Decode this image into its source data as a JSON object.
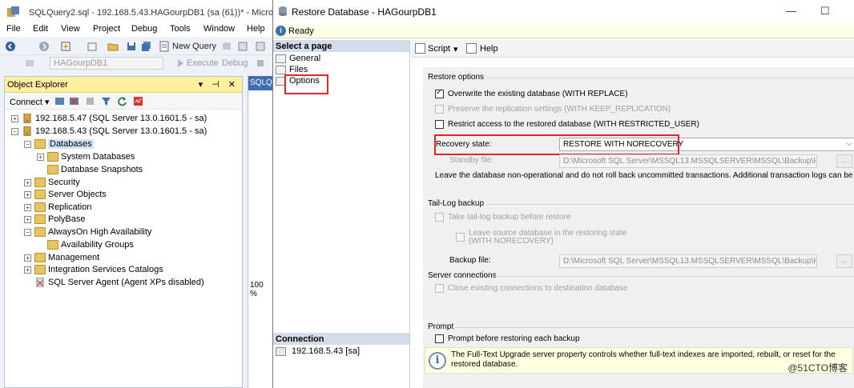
{
  "ssms": {
    "title": "SQLQuery2.sql - 192.168.5.43.HAGourpDB1 (sa (61))* - Microsoft S",
    "menu": [
      "File",
      "Edit",
      "View",
      "Project",
      "Debug",
      "Tools",
      "Window",
      "Help"
    ],
    "toolbar": {
      "new_query": "New Query",
      "db_selector": "HAGourpDB1",
      "execute": "Execute",
      "debug": "Debug"
    },
    "object_explorer": {
      "title": "Object Explorer",
      "pin_controls": "▾ ⊣ ✕",
      "connect": "Connect ▾",
      "nodes": [
        {
          "label": "192.168.5.47 (SQL Server 13.0.1601.5 - sa)",
          "expander": "+"
        },
        {
          "label": "192.168.5.43 (SQL Server 13.0.1601.5 - sa)",
          "expander": "−"
        },
        {
          "label": "Databases",
          "expander": "−"
        },
        {
          "label": "System Databases",
          "expander": "+"
        },
        {
          "label": "Database Snapshots",
          "expander": ""
        },
        {
          "label": "Security",
          "expander": "+"
        },
        {
          "label": "Server Objects",
          "expander": "+"
        },
        {
          "label": "Replication",
          "expander": "+"
        },
        {
          "label": "PolyBase",
          "expander": "+"
        },
        {
          "label": "AlwaysOn High Availability",
          "expander": "−"
        },
        {
          "label": "Availability Groups",
          "expander": ""
        },
        {
          "label": "Management",
          "expander": "+"
        },
        {
          "label": "Integration Services Catalogs",
          "expander": "+"
        },
        {
          "label": "SQL Server Agent (Agent XPs disabled)",
          "expander": ""
        }
      ]
    },
    "editor_tab": "SQLQ",
    "zoom": "100 %"
  },
  "dialog": {
    "title": "Restore Database - HAGourpDB1",
    "status": "Ready",
    "select_page_header": "Select a page",
    "pages": [
      "General",
      "Files",
      "Options"
    ],
    "connection_header": "Connection",
    "connection_item": "192.168.5.43 [sa]",
    "toolbar": {
      "script": "Script",
      "script_arrow": "▾",
      "help": "Help"
    },
    "restore_options": {
      "title": "Restore options",
      "overwrite": "Overwrite the existing database (WITH REPLACE)",
      "preserve": "Preserve the replication settings (WITH KEEP_REPLICATION)",
      "restrict": "Restrict access to the restored database (WITH RESTRICTED_USER)",
      "recovery_label": "Recovery state:",
      "recovery_value": "RESTORE WITH NORECOVERY",
      "standby_label": "Standby file:",
      "standby_value": "D:\\Microsoft SQL Server\\MSSQL13.MSSQLSERVER\\MSSQL\\Backup\\HAG",
      "standby_btn": "...",
      "description": "Leave the database non-operational and do not roll back uncommitted transactions. Additional transaction logs can be restored."
    },
    "tail_log": {
      "title": "Tail-Log backup",
      "take_backup": "Take tail-log backup before restore",
      "leave_source_1": "Leave source database in the restoring state",
      "leave_source_2": "(WITH NORECOVERY)",
      "backup_file_label": "Backup file:",
      "backup_file_value": "D:\\Microsoft SQL Server\\MSSQL13.MSSQLSERVER\\MSSQL\\Backup\\HAG",
      "backup_btn": "..."
    },
    "server_connections": {
      "title": "Server connections",
      "close_existing": "Close existing connections to destination database"
    },
    "prompt": {
      "title": "Prompt",
      "prompt_before": "Prompt before restoring each backup"
    },
    "info": {
      "icon": "i",
      "text": "The Full-Text Upgrade server property controls whether full-text indexes are imported, rebuilt, or reset for the restored database."
    }
  },
  "watermark": "@51CTO博客",
  "colors": {
    "highlight_box": "#e0262b",
    "oe_header": "#ffef9e",
    "status_bar": "#ffffe8"
  }
}
